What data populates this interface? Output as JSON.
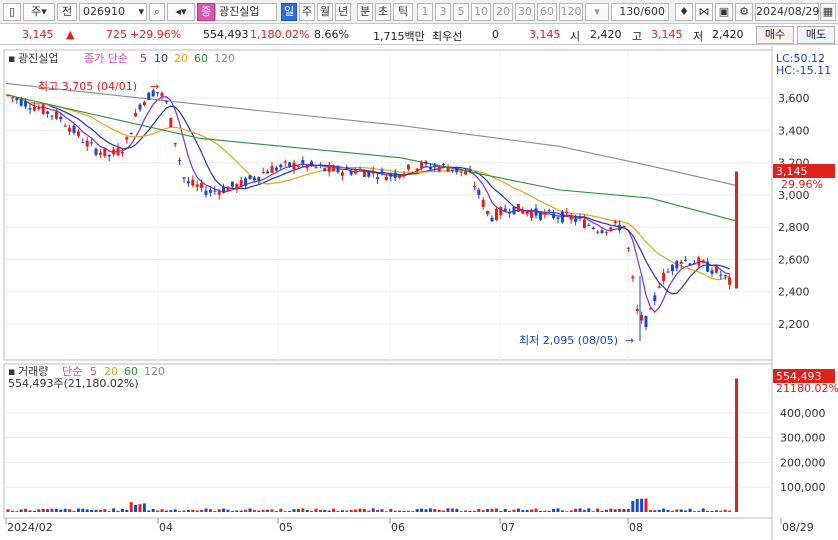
{
  "toolbar": {
    "market": "주",
    "jeon": "전",
    "code": "026910",
    "stock_badge": "증",
    "stock_name": "광진실업",
    "periods": [
      "일",
      "주",
      "월",
      "년",
      "분",
      "초",
      "틱"
    ],
    "numbers": [
      "1",
      "3",
      "5",
      "10",
      "20",
      "30",
      "60",
      "120"
    ],
    "count": "130/600",
    "date": "2024/08/29"
  },
  "info": {
    "price": "3,145",
    "change": "725",
    "change_pct": "+29.96%",
    "volume": "554,493",
    "volume_pct": "1,180.02%",
    "turnover": "8.66%",
    "amount": "1,715백만",
    "priority_label": "최우선",
    "priority_value": "0",
    "current": "3,145",
    "open_label": "시",
    "open": "2,420",
    "high_label": "고",
    "high": "3,145",
    "low_label": "저",
    "low": "2,420",
    "buy_button": "매수",
    "sell_button": "매도"
  },
  "price_panel": {
    "name": "광진실업",
    "ma_label": "종가 단순",
    "ma_periods": [
      "5",
      "10",
      "20",
      "60",
      "120"
    ],
    "lc": "LC:50.12",
    "hc": "HC:-15.11",
    "high_annotation": "최고 3,705 (04/01)",
    "low_annotation": "최저 2,095 (08/05)",
    "last_price": "3,145",
    "last_pct": "29.96%",
    "y_ticks": [
      "3,600",
      "3,400",
      "3,200",
      "3,000",
      "2,800",
      "2,600",
      "2,400",
      "2,200"
    ]
  },
  "volume_panel": {
    "title": "거래량",
    "ma_label": "단순",
    "ma_periods": [
      "5",
      "20",
      "60",
      "120"
    ],
    "readout": "554,493주(21,180.02%)",
    "last_volume": "554,493",
    "last_pct": "21180.02%",
    "y_ticks": [
      "400,000",
      "300,000",
      "200,000",
      "100,000"
    ]
  },
  "x_axis": {
    "labels": [
      "2024/02",
      "04",
      "05",
      "06",
      "07",
      "08",
      "08/29"
    ]
  },
  "colors": {
    "up": "#e0201b",
    "down": "#1848c6",
    "ma5": "#8a2bd6",
    "ma10": "#1c38b8",
    "ma20": "#e8a21a",
    "ma60": "#2f8f3c",
    "ma120": "#8c8c8c"
  },
  "chart_data": {
    "type": "candlestick",
    "description_series": [
      {
        "name": "종가",
        "x": [
          "02/01",
          "02/15",
          "03/01",
          "03/15",
          "03/22",
          "04/01",
          "04/10",
          "04/20",
          "05/01",
          "05/15",
          "06/01",
          "06/15",
          "07/01",
          "07/10",
          "07/20",
          "08/01",
          "08/05",
          "08/10",
          "08/20",
          "08/28",
          "08/29"
        ],
        "values": [
          3620,
          3520,
          3380,
          3250,
          3450,
          3600,
          3050,
          3020,
          3230,
          3180,
          3150,
          3150,
          2960,
          2910,
          2880,
          2800,
          2095,
          2550,
          2600,
          2420,
          3145
        ]
      }
    ]
  }
}
